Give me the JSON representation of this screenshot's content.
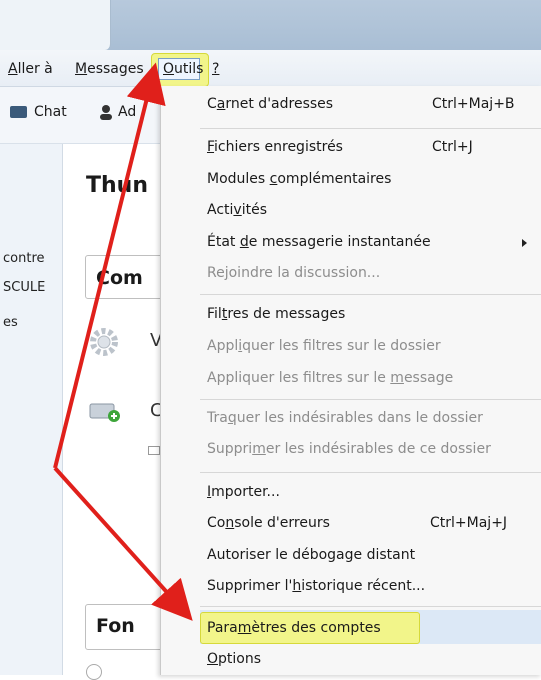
{
  "menubar": {
    "items": [
      "Aller à",
      "Messages",
      "Outils",
      "?"
    ]
  },
  "toolbar": {
    "chat_label": "Chat",
    "addressbook_label": "Ad"
  },
  "left_pane": {
    "line1": "contre",
    "line2": "SCULE",
    "line3": "es"
  },
  "content": {
    "heading_partial": "Thun",
    "section1_partial": "Com",
    "row1_partial": "V",
    "row2_partial": "C",
    "section2_partial": "Fon"
  },
  "outils_menu": {
    "carnet": {
      "label": "Carnet d'adresses",
      "shortcut": "Ctrl+Maj+B"
    },
    "fichiers": {
      "label": "Fichiers enregistrés",
      "shortcut": "Ctrl+J"
    },
    "modules": {
      "label": "Modules complémentaires"
    },
    "activites": {
      "label": "Activités"
    },
    "etat": {
      "label": "État de messagerie instantanée"
    },
    "rejoindre": {
      "label": "Rejoindre la discussion..."
    },
    "filtres": {
      "label": "Filtres de messages"
    },
    "appliquer_dossier": {
      "label": "Appliquer les filtres sur le dossier"
    },
    "appliquer_message": {
      "label": "Appliquer les filtres sur le message"
    },
    "traquer": {
      "label": "Traquer les indésirables dans le dossier"
    },
    "supprimer_indesirables": {
      "label": "Supprimer les indésirables de ce dossier"
    },
    "importer": {
      "label": "Importer..."
    },
    "console": {
      "label": "Console d'erreurs",
      "shortcut": "Ctrl+Maj+J"
    },
    "debogage": {
      "label": "Autoriser le débogage distant"
    },
    "historique": {
      "label": "Supprimer l'historique récent..."
    },
    "parametres": {
      "label": "Paramètres des comptes"
    },
    "options": {
      "label": "Options"
    }
  },
  "colors": {
    "highlight": "#f2f58a",
    "arrow": "#e0201b"
  }
}
